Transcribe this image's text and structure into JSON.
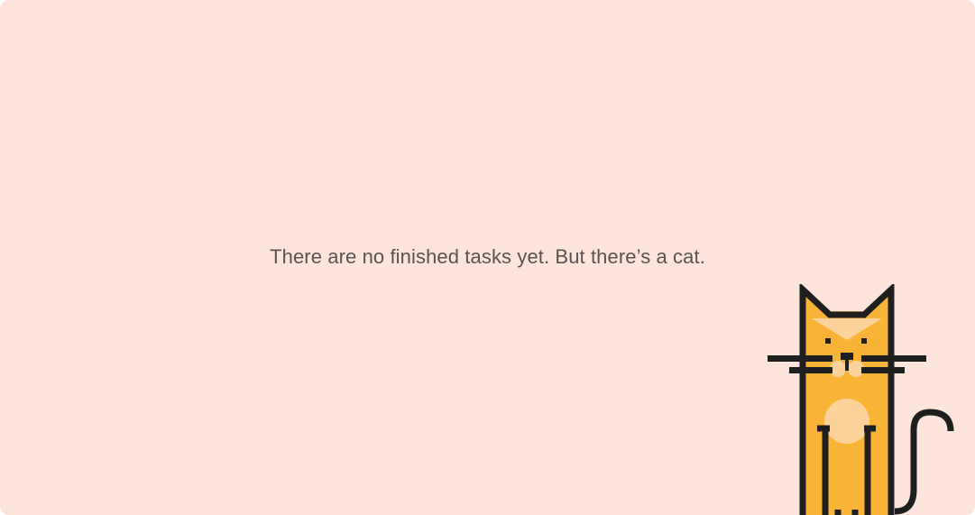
{
  "empty_state": {
    "message": "There are no finished tasks yet. But there’s a cat.",
    "illustration": "cat-illustration"
  },
  "colors": {
    "panel_background": "#fde5db",
    "message_text": "#5a5350",
    "cat_body": "#f9b437",
    "cat_light": "#fbd39a",
    "cat_outline": "#1f1f1f"
  }
}
